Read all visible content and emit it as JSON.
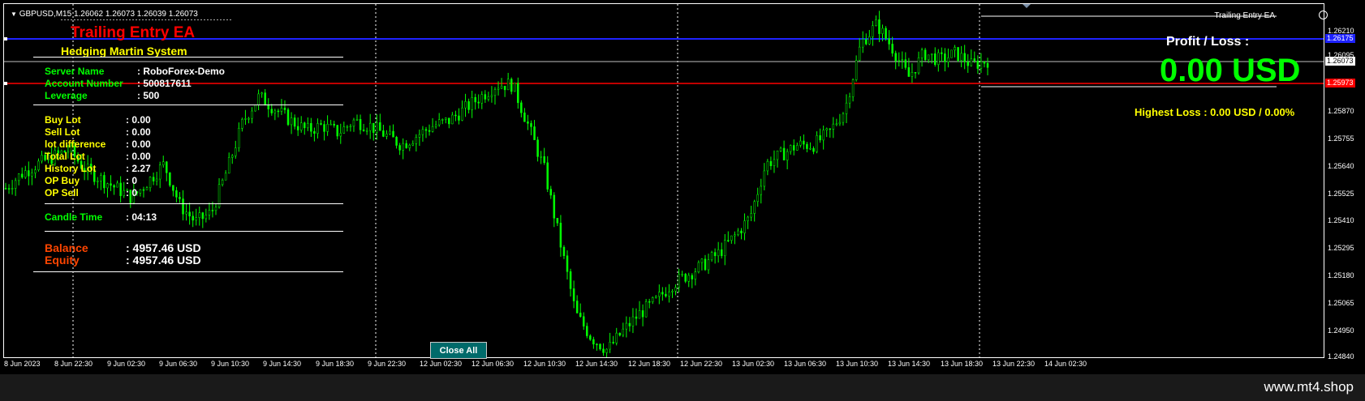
{
  "header": {
    "symbol_info": "GBPUSD,M15  1.26062 1.26073 1.26039 1.26073",
    "ea_label": "Trailing Entry EA"
  },
  "panel": {
    "title": "Trailing Entry EA",
    "subtitle": "Hedging Martin System",
    "server_label": "Server Name",
    "server_value": ": RoboForex-Demo",
    "account_label": "Account Number",
    "account_value": ": 500817611",
    "leverage_label": "Leverage",
    "leverage_value": ": 500",
    "buy_lot_label": "Buy  Lot",
    "buy_lot_value": ":  0.00",
    "sell_lot_label": "Sell Lot",
    "sell_lot_value": ":  0.00",
    "lot_diff_label": "lot difference",
    "lot_diff_value": ":  0.00",
    "total_lot_label": "Total Lot",
    "total_lot_value": ":  0.00",
    "history_lot_label": "History Lot",
    "history_lot_value": ":  2.27",
    "op_buy_label": "OP Buy",
    "op_buy_value": ":    0",
    "op_sell_label": "OP Sell",
    "op_sell_value": ":    0",
    "candle_time_label": "Candle Time",
    "candle_time_value": ":  04:13",
    "balance_label": "Balance",
    "balance_value": ":  4957.46 USD",
    "equity_label": "Equity",
    "equity_value": ":  4957.46 USD",
    "title_color": "#ff0000",
    "subtitle_color": "#ffff00",
    "info_color": "#00ff00",
    "lot_color": "#ffff00",
    "balance_color": "#ff4500"
  },
  "profit": {
    "title": "Profit / Loss :",
    "value": "0.00 USD",
    "highest_loss": "Highest Loss  : 0.00 USD / 0.00%"
  },
  "buttons": {
    "close_all": "Close All"
  },
  "price_axis": {
    "ticks": [
      "1.26210",
      "1.26095",
      "1.25870",
      "1.25755",
      "1.25640",
      "1.25525",
      "1.25410",
      "1.25295",
      "1.25180",
      "1.25065",
      "1.24950",
      "1.24840"
    ],
    "tag_blue": "1.26175",
    "tag_current": "1.26073",
    "tag_red": "1.25973",
    "blue_color": "#1e22ff",
    "red_color": "#ff0000"
  },
  "time_axis": {
    "labels": [
      "8 Jun 2023",
      "8 Jun 22:30",
      "9 Jun 02:30",
      "9 Jun 06:30",
      "9 Jun 10:30",
      "9 Jun 14:30",
      "9 Jun 18:30",
      "9 Jun 22:30",
      "12 Jun 02:30",
      "12 Jun 06:30",
      "12 Jun 10:30",
      "12 Jun 14:30",
      "12 Jun 18:30",
      "12 Jun 22:30",
      "13 Jun 02:30",
      "13 Jun 06:30",
      "13 Jun 10:30",
      "13 Jun 14:30",
      "13 Jun 18:30",
      "13 Jun 22:30",
      "14 Jun 02:30"
    ]
  },
  "chart_data": {
    "type": "candlestick",
    "candle_color": "#00ff00",
    "close_path": [
      1.2552,
      1.2558,
      1.2562,
      1.2565,
      1.2568,
      1.256,
      1.2556,
      1.2552,
      1.2548,
      1.2555,
      1.2562,
      1.2545,
      1.2538,
      1.2542,
      1.256,
      1.258,
      1.259,
      1.2585,
      1.258,
      1.2576,
      1.2578,
      1.2575,
      1.258,
      1.2578,
      1.2574,
      1.257,
      1.2574,
      1.2578,
      1.258,
      1.2585,
      1.259,
      1.2595,
      1.2595,
      1.2578,
      1.256,
      1.253,
      1.25,
      1.249,
      1.2485,
      1.2493,
      1.25,
      1.2505,
      1.2512,
      1.2516,
      1.252,
      1.2525,
      1.2532,
      1.254,
      1.2562,
      1.2566,
      1.257,
      1.257,
      1.2575,
      1.2585,
      1.2612,
      1.262,
      1.261,
      1.2598,
      1.2608,
      1.2605,
      1.2608,
      1.2603,
      1.2605
    ],
    "ylim": [
      1.2484,
      1.2627
    ],
    "xlabel": "",
    "ylabel": ""
  }
}
